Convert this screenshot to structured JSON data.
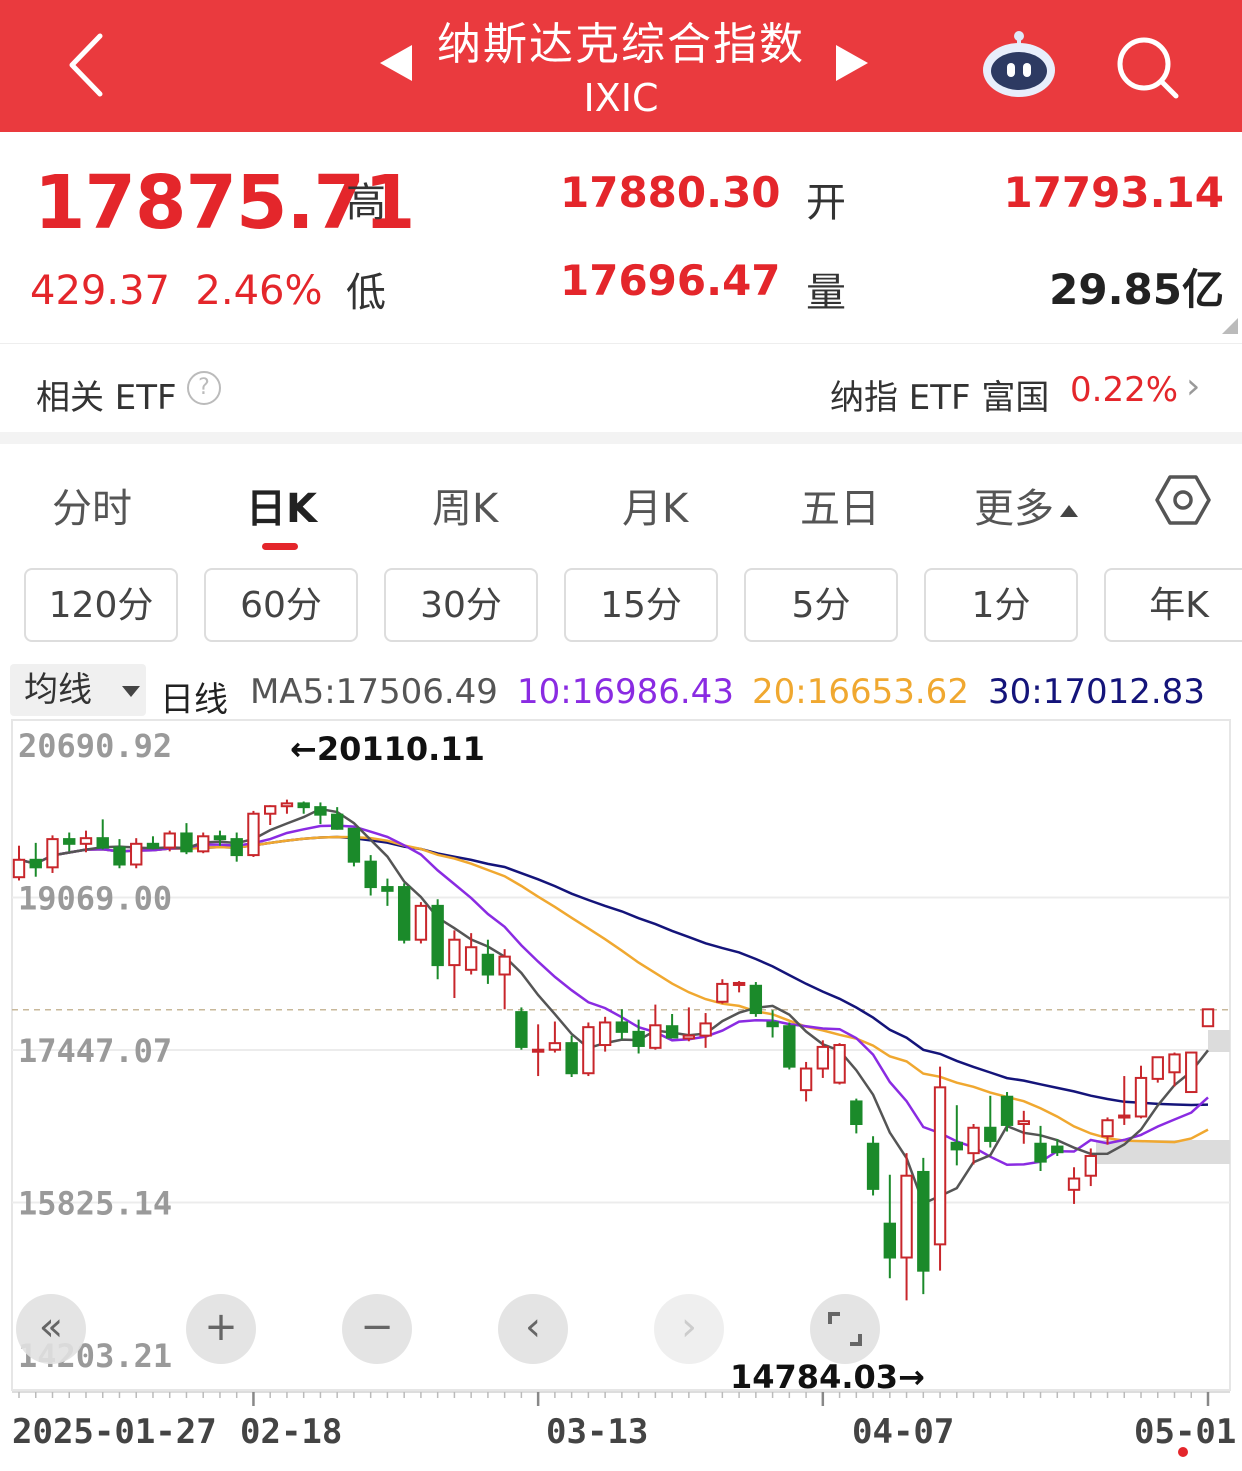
{
  "header": {
    "title": "纳斯达克综合指数",
    "code": "IXIC",
    "icons": [
      "back-chevron-icon",
      "prev-triangle-icon",
      "next-triangle-icon",
      "robot-assistant-icon",
      "search-icon"
    ]
  },
  "quote": {
    "price": "17875.71",
    "change": "429.37",
    "change_pct": "2.46%",
    "high_label": "高",
    "high": "17880.30",
    "open_label": "开",
    "open": "17793.14",
    "low_label": "低",
    "low": "17696.47",
    "volume_label": "量",
    "volume": "29.85亿",
    "up_color": "#e4262b"
  },
  "etf": {
    "label": "相关 ETF",
    "help": "?",
    "name": "纳指 ETF 富国",
    "pct": "0.22%",
    "arrow": "›"
  },
  "tabs": [
    {
      "label": "分时"
    },
    {
      "label": "日K"
    },
    {
      "label": "周K"
    },
    {
      "label": "月K"
    },
    {
      "label": "五日"
    },
    {
      "label": "更多"
    }
  ],
  "periods": [
    "120分",
    "60分",
    "30分",
    "15分",
    "5分",
    "1分",
    "年K"
  ],
  "ma_bar": {
    "select_label": "均线",
    "line_type": "日线",
    "ma5": "MA5:17506.49",
    "ma10": "10:16986.43",
    "ma20": "20:16653.62",
    "ma30": "30:17012.83",
    "colors": {
      "ma5": "#555555",
      "ma10": "#8a2be2",
      "ma20": "#f0a830",
      "ma30": "#14147a"
    }
  },
  "chart_data": {
    "type": "candlestick",
    "y_ticks": [
      "20690.92",
      "19069.00",
      "17447.07",
      "15825.14",
      "14203.21"
    ],
    "ylim": [
      14203.21,
      20690.92
    ],
    "x_ticks": [
      "2025-01-27",
      "02-18",
      "03-13",
      "04-07",
      "05-01"
    ],
    "max_annotation": "←20110.11",
    "min_annotation": "14784.03→",
    "reference_line": 17875.71,
    "candles": [
      [
        19285,
        19620,
        19250,
        19470
      ],
      [
        19470,
        19650,
        19290,
        19390
      ],
      [
        19390,
        19730,
        19330,
        19690
      ],
      [
        19690,
        19760,
        19560,
        19640
      ],
      [
        19640,
        19780,
        19550,
        19700
      ],
      [
        19700,
        19900,
        19580,
        19600
      ],
      [
        19600,
        19690,
        19380,
        19420
      ],
      [
        19420,
        19700,
        19380,
        19640
      ],
      [
        19640,
        19720,
        19580,
        19600
      ],
      [
        19600,
        19780,
        19560,
        19750
      ],
      [
        19750,
        19860,
        19530,
        19560
      ],
      [
        19560,
        19760,
        19540,
        19720
      ],
      [
        19720,
        19780,
        19620,
        19690
      ],
      [
        19690,
        19760,
        19450,
        19520
      ],
      [
        19520,
        19990,
        19500,
        19960
      ],
      [
        19960,
        20050,
        19840,
        20040
      ],
      [
        20040,
        20110,
        19960,
        20070
      ],
      [
        20070,
        20090,
        19960,
        20030
      ],
      [
        20030,
        20080,
        19850,
        19950
      ],
      [
        19950,
        20030,
        19790,
        19800
      ],
      [
        19800,
        19810,
        19400,
        19450
      ],
      [
        19450,
        19520,
        19090,
        19180
      ],
      [
        19180,
        19270,
        18980,
        19140
      ],
      [
        19180,
        19220,
        18580,
        18620
      ],
      [
        18620,
        19020,
        18580,
        18980
      ],
      [
        18980,
        19050,
        18200,
        18350
      ],
      [
        18350,
        18720,
        18000,
        18620
      ],
      [
        18300,
        18690,
        18250,
        18540
      ],
      [
        18460,
        18620,
        18150,
        18250
      ],
      [
        18250,
        18520,
        17880,
        18440
      ],
      [
        17850,
        17900,
        17450,
        17480
      ],
      [
        17450,
        17720,
        17170,
        17450
      ],
      [
        17450,
        17750,
        17420,
        17520
      ],
      [
        17520,
        17600,
        17160,
        17200
      ],
      [
        17200,
        17740,
        17170,
        17690
      ],
      [
        17500,
        17800,
        17430,
        17740
      ],
      [
        17740,
        17880,
        17560,
        17640
      ],
      [
        17640,
        17770,
        17410,
        17490
      ],
      [
        17470,
        17930,
        17450,
        17710
      ],
      [
        17700,
        17830,
        17570,
        17580
      ],
      [
        17570,
        17900,
        17540,
        17600
      ],
      [
        17600,
        17840,
        17470,
        17730
      ],
      [
        17960,
        18200,
        17940,
        18150
      ],
      [
        18150,
        18180,
        18060,
        18160
      ],
      [
        18130,
        18170,
        17800,
        17840
      ],
      [
        17740,
        17870,
        17580,
        17700
      ],
      [
        17700,
        17740,
        17240,
        17270
      ],
      [
        17020,
        17320,
        16900,
        17250
      ],
      [
        17250,
        17550,
        17150,
        17480
      ],
      [
        17100,
        17520,
        17080,
        17500
      ],
      [
        16900,
        16930,
        16560,
        16660
      ],
      [
        16450,
        16530,
        15900,
        15970
      ],
      [
        15600,
        16120,
        15020,
        15240
      ],
      [
        15240,
        16350,
        14784,
        16110
      ],
      [
        16150,
        16300,
        14850,
        15100
      ],
      [
        15380,
        17270,
        15100,
        17050
      ],
      [
        16460,
        16860,
        16220,
        16390
      ],
      [
        16350,
        16660,
        16230,
        16620
      ],
      [
        16620,
        16960,
        16410,
        16480
      ],
      [
        16950,
        17000,
        16580,
        16650
      ],
      [
        16660,
        16800,
        16450,
        16690
      ],
      [
        16450,
        16640,
        16160,
        16260
      ],
      [
        16420,
        16500,
        16320,
        16360
      ],
      [
        15960,
        16200,
        15810,
        16080
      ],
      [
        16110,
        16400,
        16000,
        16320
      ],
      [
        16530,
        16730,
        16440,
        16700
      ],
      [
        16730,
        17170,
        16650,
        16750
      ],
      [
        16740,
        17280,
        16720,
        17150
      ],
      [
        17140,
        17350,
        17100,
        17370
      ],
      [
        17210,
        17420,
        17060,
        17400
      ],
      [
        17000,
        17400,
        17020,
        17420
      ],
      [
        17700,
        17880,
        17700,
        17880
      ]
    ]
  }
}
